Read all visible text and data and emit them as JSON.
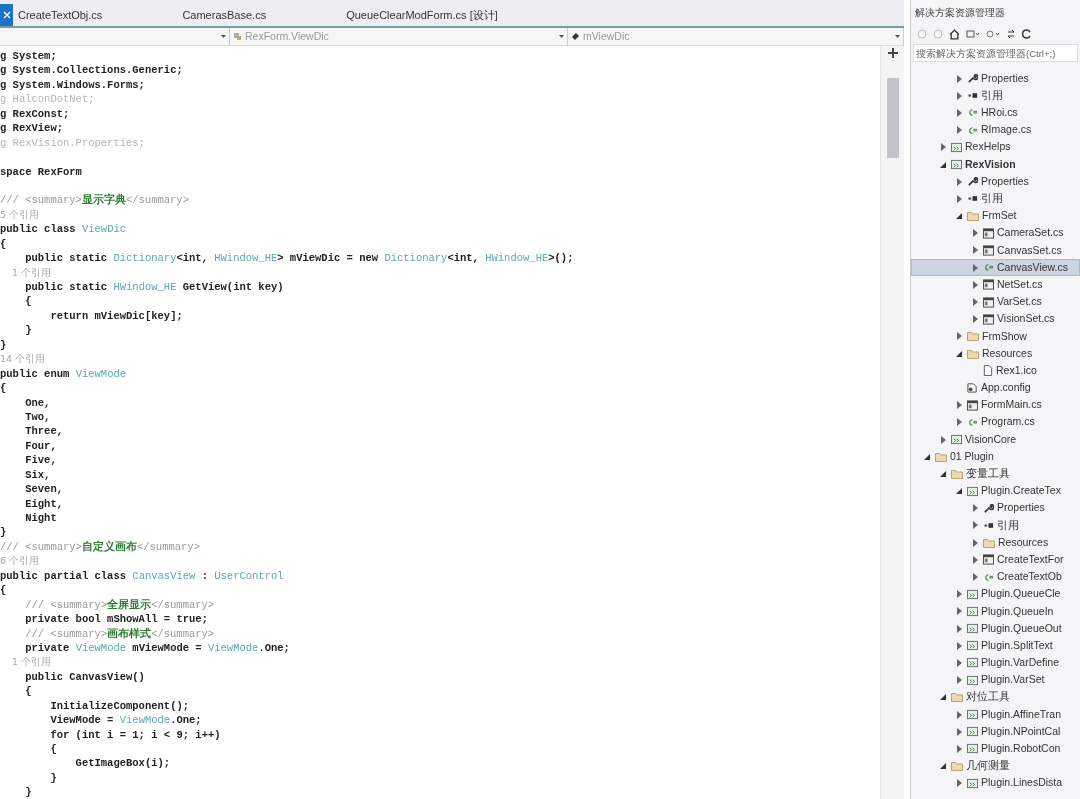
{
  "tabs": [
    {
      "label": "CreateTextObj.cs",
      "selected": false
    },
    {
      "label": "CamerasBase.cs",
      "selected": false
    },
    {
      "label": "QueueClearModForm.cs [设计]",
      "selected": false
    }
  ],
  "nav_bar": [
    {
      "kind": "blank"
    },
    {
      "kind": "class",
      "text": "RexForm.ViewDic"
    },
    {
      "kind": "member",
      "text": "mViewDic"
    }
  ],
  "code_lines": [
    {
      "segments": [
        {
          "kind": "plain",
          "text": "g System;"
        }
      ]
    },
    {
      "segments": [
        {
          "kind": "plain",
          "text": "g System.Collections.Generic;"
        }
      ]
    },
    {
      "segments": [
        {
          "kind": "plain",
          "text": "g System.Windows.Forms;"
        }
      ]
    },
    {
      "segments": [
        {
          "kind": "dim",
          "text": "g HalconDotNet;"
        }
      ]
    },
    {
      "segments": [
        {
          "kind": "plain",
          "text": "g RexConst;"
        }
      ]
    },
    {
      "segments": [
        {
          "kind": "plain",
          "text": "g RexView;"
        }
      ]
    },
    {
      "segments": [
        {
          "kind": "dim",
          "text": "g RexVision.Properties;"
        }
      ]
    },
    {
      "kind": "blank"
    },
    {
      "segments": [
        {
          "kind": "plain",
          "text": "space RexForm"
        }
      ]
    },
    {
      "kind": "blank"
    },
    {
      "segments": [
        {
          "kind": "comment",
          "text": "/// <summary>"
        },
        {
          "kind": "doc",
          "text": "显示字典"
        },
        {
          "kind": "comment",
          "text": "</summary>"
        }
      ]
    },
    {
      "segments": [
        {
          "kind": "lens",
          "text": "5 个引用"
        }
      ]
    },
    {
      "segments": [
        {
          "kind": "plain",
          "text": "public class "
        },
        {
          "kind": "type",
          "text": "ViewDic"
        }
      ]
    },
    {
      "segments": [
        {
          "kind": "plain",
          "text": "{"
        }
      ]
    },
    {
      "segments": [
        {
          "kind": "plain",
          "text": "    public static "
        },
        {
          "kind": "type",
          "text": "Dictionary"
        },
        {
          "kind": "plain",
          "text": "<int, "
        },
        {
          "kind": "type",
          "text": "HWindow_HE"
        },
        {
          "kind": "plain",
          "text": "> mViewDic = new "
        },
        {
          "kind": "type",
          "text": "Dictionary"
        },
        {
          "kind": "plain",
          "text": "<int, "
        },
        {
          "kind": "type",
          "text": "HWindow_HE"
        },
        {
          "kind": "plain",
          "text": ">();"
        }
      ]
    },
    {
      "segments": [
        {
          "kind": "lens",
          "text": "    1 个引用"
        }
      ]
    },
    {
      "segments": [
        {
          "kind": "plain",
          "text": "    public static "
        },
        {
          "kind": "type",
          "text": "HWindow_HE"
        },
        {
          "kind": "plain",
          "text": " GetView(int key)"
        }
      ]
    },
    {
      "segments": [
        {
          "kind": "plain",
          "text": "    {"
        }
      ]
    },
    {
      "segments": [
        {
          "kind": "plain",
          "text": "        return mViewDic[key];"
        }
      ]
    },
    {
      "segments": [
        {
          "kind": "plain",
          "text": "    }"
        }
      ]
    },
    {
      "segments": [
        {
          "kind": "plain",
          "text": "}"
        }
      ]
    },
    {
      "segments": [
        {
          "kind": "lens",
          "text": "14 个引用"
        }
      ]
    },
    {
      "segments": [
        {
          "kind": "plain",
          "text": "public enum "
        },
        {
          "kind": "type",
          "text": "ViewMode"
        }
      ]
    },
    {
      "segments": [
        {
          "kind": "plain",
          "text": "{"
        }
      ]
    },
    {
      "segments": [
        {
          "kind": "plain",
          "text": "    One,"
        }
      ]
    },
    {
      "segments": [
        {
          "kind": "plain",
          "text": "    Two,"
        }
      ]
    },
    {
      "segments": [
        {
          "kind": "plain",
          "text": "    Three,"
        }
      ]
    },
    {
      "segments": [
        {
          "kind": "plain",
          "text": "    Four,"
        }
      ]
    },
    {
      "segments": [
        {
          "kind": "plain",
          "text": "    Five,"
        }
      ]
    },
    {
      "segments": [
        {
          "kind": "plain",
          "text": "    Six,"
        }
      ]
    },
    {
      "segments": [
        {
          "kind": "plain",
          "text": "    Seven,"
        }
      ]
    },
    {
      "segments": [
        {
          "kind": "plain",
          "text": "    Eight,"
        }
      ]
    },
    {
      "segments": [
        {
          "kind": "plain",
          "text": "    Night"
        }
      ]
    },
    {
      "segments": [
        {
          "kind": "plain",
          "text": "}"
        }
      ]
    },
    {
      "segments": [
        {
          "kind": "comment",
          "text": "/// <summary>"
        },
        {
          "kind": "doc",
          "text": "自定义画布"
        },
        {
          "kind": "comment",
          "text": "</summary>"
        }
      ]
    },
    {
      "segments": [
        {
          "kind": "lens",
          "text": "6 个引用"
        }
      ]
    },
    {
      "segments": [
        {
          "kind": "plain",
          "text": "public partial class "
        },
        {
          "kind": "type",
          "text": "CanvasView"
        },
        {
          "kind": "plain",
          "text": " : "
        },
        {
          "kind": "type",
          "text": "UserControl"
        }
      ]
    },
    {
      "segments": [
        {
          "kind": "plain",
          "text": "{"
        }
      ]
    },
    {
      "segments": [
        {
          "kind": "comment",
          "text": "    /// <summary>"
        },
        {
          "kind": "doc",
          "text": "全屏显示"
        },
        {
          "kind": "comment",
          "text": "</summary>"
        }
      ]
    },
    {
      "segments": [
        {
          "kind": "plain",
          "text": "    private bool mShowAll = true;"
        }
      ]
    },
    {
      "segments": [
        {
          "kind": "comment",
          "text": "    /// <summary>"
        },
        {
          "kind": "doc",
          "text": "画布样式"
        },
        {
          "kind": "comment",
          "text": "</summary>"
        }
      ]
    },
    {
      "segments": [
        {
          "kind": "plain",
          "text": "    private "
        },
        {
          "kind": "type",
          "text": "ViewMode"
        },
        {
          "kind": "plain",
          "text": " mViewMode = "
        },
        {
          "kind": "type",
          "text": "ViewMode"
        },
        {
          "kind": "plain",
          "text": ".One;"
        }
      ]
    },
    {
      "segments": [
        {
          "kind": "lens",
          "text": "    1 个引用"
        }
      ]
    },
    {
      "segments": [
        {
          "kind": "plain",
          "text": "    public CanvasView()"
        }
      ]
    },
    {
      "segments": [
        {
          "kind": "plain",
          "text": "    {"
        }
      ]
    },
    {
      "segments": [
        {
          "kind": "plain",
          "text": "        InitializeComponent();"
        }
      ]
    },
    {
      "segments": [
        {
          "kind": "plain",
          "text": "        ViewMode = "
        },
        {
          "kind": "type",
          "text": "ViewMode"
        },
        {
          "kind": "plain",
          "text": ".One;"
        }
      ]
    },
    {
      "segments": [
        {
          "kind": "plain",
          "text": "        for (int i = 1; i < 9; i++)"
        }
      ]
    },
    {
      "segments": [
        {
          "kind": "plain",
          "text": "        {"
        }
      ]
    },
    {
      "segments": [
        {
          "kind": "plain",
          "text": "            GetImageBox(i);"
        }
      ]
    },
    {
      "segments": [
        {
          "kind": "plain",
          "text": "        }"
        }
      ]
    },
    {
      "segments": [
        {
          "kind": "plain",
          "text": "    }"
        }
      ]
    }
  ],
  "solution_explorer": {
    "title": "解决方案资源管理器",
    "search": {
      "placeholder": "搜索解决方案资源管理器(Ctrl+;)"
    },
    "tree": [
      {
        "children": [
          {
            "children": [
              {
                "kind": "wrench",
                "label": "Properties",
                "expanded": false,
                "selected": false
              },
              {
                "kind": "ref",
                "label": "引用",
                "expanded": false,
                "selected": false
              },
              {
                "kind": "cs",
                "label": "HRoi.cs",
                "expanded": false,
                "selected": false
              },
              {
                "kind": "cs",
                "label": "RImage.cs",
                "expanded": false,
                "selected": false
              }
            ]
          },
          {
            "kind": "project",
            "label": "RexHelps",
            "expanded": false,
            "selected": false,
            "startup": false
          },
          {
            "kind": "project",
            "label": "RexVision",
            "expanded": true,
            "selected": false,
            "startup": true,
            "children": [
              {
                "kind": "wrench",
                "label": "Properties",
                "expanded": false,
                "selected": false
              },
              {
                "kind": "ref",
                "label": "引用",
                "expanded": false,
                "selected": false
              },
              {
                "kind": "folder",
                "label": "FrmSet",
                "expanded": true,
                "selected": false,
                "children": [
                  {
                    "kind": "form",
                    "label": "CameraSet.cs",
                    "expanded": false,
                    "selected": false
                  },
                  {
                    "kind": "form",
                    "label": "CanvasSet.cs",
                    "expanded": false,
                    "selected": false
                  },
                  {
                    "kind": "cs",
                    "label": "CanvasView.cs",
                    "expanded": false,
                    "selected": true
                  },
                  {
                    "kind": "form",
                    "label": "NetSet.cs",
                    "expanded": false,
                    "selected": false
                  },
                  {
                    "kind": "form",
                    "label": "VarSet.cs",
                    "expanded": false,
                    "selected": false
                  },
                  {
                    "kind": "form",
                    "label": "VisionSet.cs",
                    "expanded": false,
                    "selected": false
                  }
                ]
              },
              {
                "kind": "folder",
                "label": "FrmShow",
                "expanded": false,
                "selected": false
              },
              {
                "kind": "folder",
                "label": "Resources",
                "expanded": true,
                "selected": false,
                "children": [
                  {
                    "kind": "file",
                    "label": "Rex1.ico",
                    "selected": false
                  }
                ]
              },
              {
                "kind": "config",
                "label": "App.config",
                "selected": false
              },
              {
                "kind": "form",
                "label": "FormMain.cs",
                "expanded": false,
                "selected": false
              },
              {
                "kind": "cs",
                "label": "Program.cs",
                "expanded": false,
                "selected": false
              }
            ]
          },
          {
            "kind": "project",
            "label": "VisionCore",
            "expanded": false,
            "selected": false,
            "startup": false
          }
        ]
      },
      {
        "kind": "folder",
        "label": "01 Plugin",
        "expanded": true,
        "selected": false,
        "children": [
          {
            "kind": "folder",
            "label": "变量工具",
            "expanded": true,
            "selected": false,
            "children": [
              {
                "kind": "project",
                "label": "Plugin.CreateTex",
                "expanded": true,
                "selected": false,
                "startup": false,
                "children": [
                  {
                    "kind": "wrench",
                    "label": "Properties",
                    "expanded": false,
                    "selected": false
                  },
                  {
                    "kind": "ref",
                    "label": "引用",
                    "expanded": false,
                    "selected": false
                  },
                  {
                    "kind": "folder",
                    "label": "Resources",
                    "expanded": false,
                    "selected": false
                  },
                  {
                    "kind": "form",
                    "label": "CreateTextFor",
                    "expanded": false,
                    "selected": false
                  },
                  {
                    "kind": "cs",
                    "label": "CreateTextOb",
                    "expanded": false,
                    "selected": false
                  }
                ]
              },
              {
                "kind": "project",
                "label": "Plugin.QueueCle",
                "expanded": false,
                "selected": false,
                "startup": false
              },
              {
                "kind": "project",
                "label": "Plugin.QueueIn",
                "expanded": false,
                "selected": false,
                "startup": false
              },
              {
                "kind": "project",
                "label": "Plugin.QueueOut",
                "expanded": false,
                "selected": false,
                "startup": false
              },
              {
                "kind": "project",
                "label": "Plugin.SplitText",
                "expanded": false,
                "selected": false,
                "startup": false
              },
              {
                "kind": "project",
                "label": "Plugin.VarDefine",
                "expanded": false,
                "selected": false,
                "startup": false
              },
              {
                "kind": "project",
                "label": "Plugin.VarSet",
                "expanded": false,
                "selected": false,
                "startup": false
              }
            ]
          },
          {
            "kind": "folder",
            "label": "对位工具",
            "expanded": true,
            "selected": false,
            "children": [
              {
                "kind": "project",
                "label": "Plugin.AffineTran",
                "expanded": false,
                "selected": false,
                "startup": false
              },
              {
                "kind": "project",
                "label": "Plugin.NPointCal",
                "expanded": false,
                "selected": false,
                "startup": false
              },
              {
                "kind": "project",
                "label": "Plugin.RobotCon",
                "expanded": false,
                "selected": false,
                "startup": false
              }
            ]
          },
          {
            "kind": "folder",
            "label": "几何测量",
            "expanded": true,
            "selected": false,
            "children": [
              {
                "kind": "project",
                "label": "Plugin.LinesDista",
                "expanded": false,
                "selected": false,
                "startup": false
              }
            ]
          }
        ]
      }
    ]
  }
}
